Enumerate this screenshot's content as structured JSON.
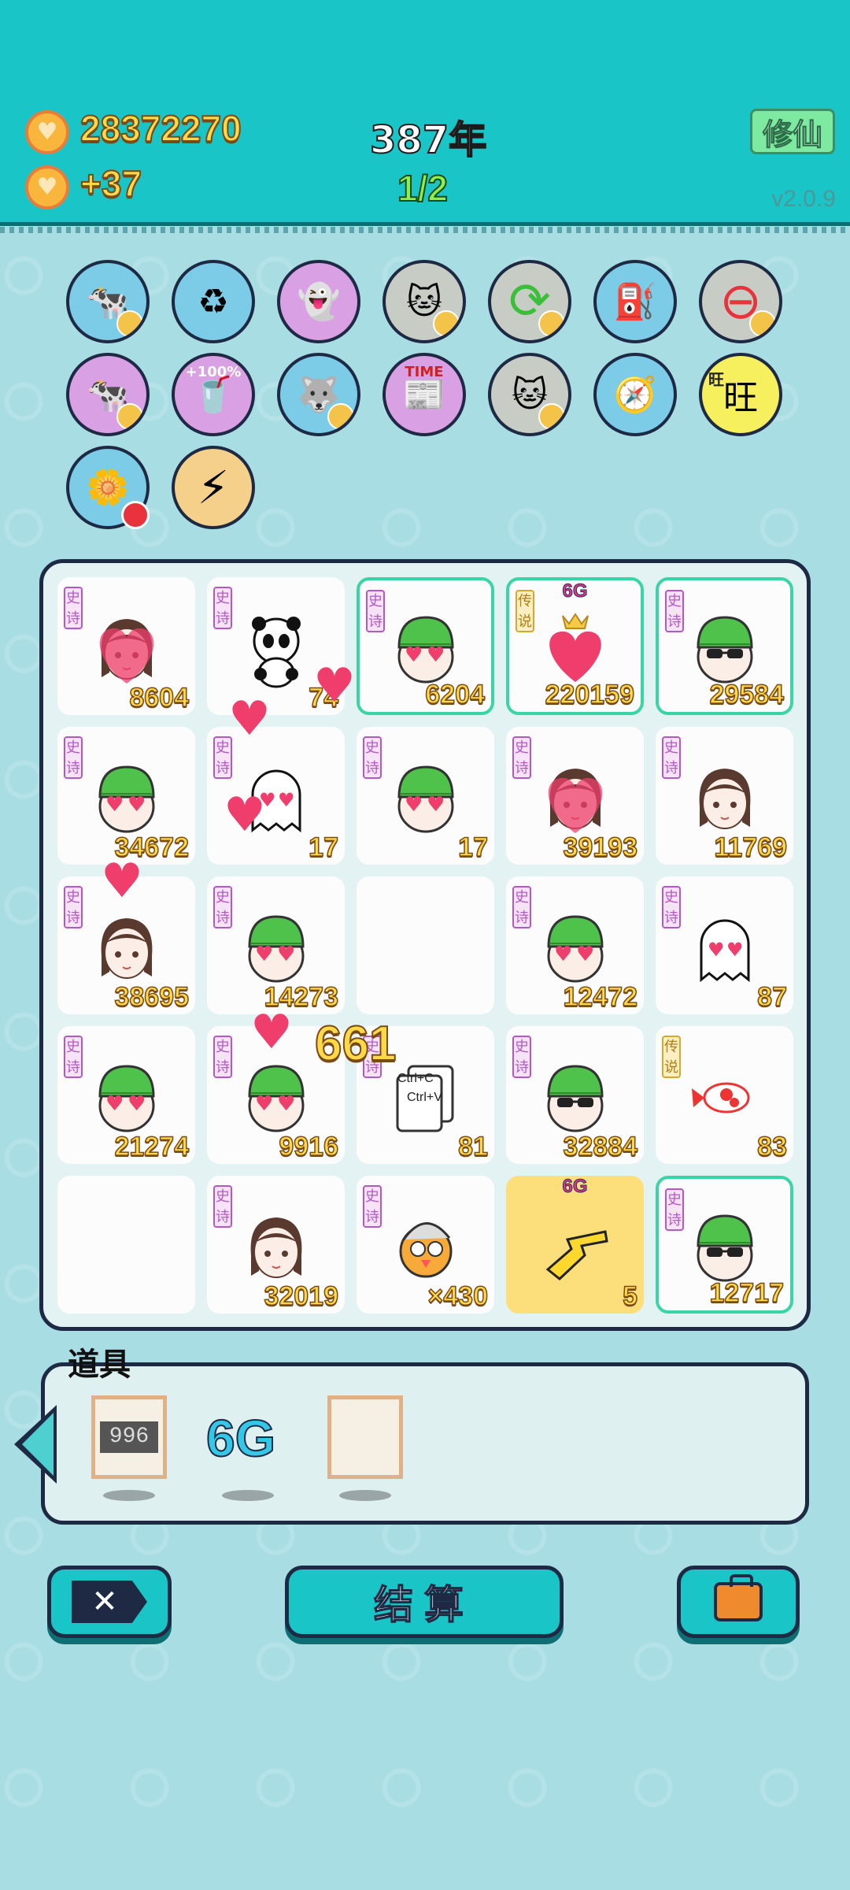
{
  "header": {
    "coins": "28372270",
    "income": "+37",
    "year": "387年",
    "page": "1/2",
    "xiuxian": "修仙",
    "version": "v2.0.9"
  },
  "abilities": [
    {
      "icon": "cow-twins-icon",
      "color": "blue"
    },
    {
      "icon": "recycle-bag-icon",
      "color": "blue"
    },
    {
      "icon": "ghost-lantern-icon",
      "color": "purple"
    },
    {
      "icon": "cat-glasses-icon",
      "color": "tan"
    },
    {
      "icon": "refresh-icon",
      "color": "tan"
    },
    {
      "icon": "pump-icon",
      "color": "blue"
    },
    {
      "icon": "minus-circle-icon",
      "color": "tan"
    },
    {
      "icon": "cow-twins-icon",
      "color": "purple"
    },
    {
      "icon": "drink-plus100-icon",
      "color": "purple",
      "text": "+100%"
    },
    {
      "icon": "husky-icon",
      "color": "blue"
    },
    {
      "icon": "time-magazine-icon",
      "color": "purple",
      "text": "TIME"
    },
    {
      "icon": "cat-glasses-icon",
      "color": "tan"
    },
    {
      "icon": "compass-icon",
      "color": "blue"
    },
    {
      "icon": "wang-icon",
      "color": "yellow",
      "text": "旺"
    },
    {
      "icon": "flower-pot-icon",
      "color": "blue"
    },
    {
      "icon": "lightning-icon",
      "color": "gold"
    }
  ],
  "board": {
    "tag_epic": "史诗",
    "tag_legend": "传说",
    "six_g": "6G",
    "ctrl_c": "Ctrl+C",
    "ctrl_v": "Ctrl+V",
    "cells": [
      {
        "face": "girl-heart",
        "tag": "epic",
        "value": "8604"
      },
      {
        "face": "panda",
        "tag": "epic",
        "value": "74"
      },
      {
        "face": "green-heart",
        "tag": "epic",
        "value": "6204",
        "hl": true
      },
      {
        "face": "heart-crown",
        "tag": "legend",
        "value": "220159",
        "hl": true,
        "sixg": true
      },
      {
        "face": "green-shades",
        "tag": "epic",
        "value": "29584",
        "hl": true
      },
      {
        "face": "green-heart",
        "tag": "epic",
        "value": "34672"
      },
      {
        "face": "ghost",
        "tag": "epic",
        "value": "17"
      },
      {
        "face": "green-heart",
        "tag": "epic",
        "value": "17"
      },
      {
        "face": "girl-heart",
        "tag": "epic",
        "value": "39193"
      },
      {
        "face": "girl",
        "tag": "epic",
        "value": "11769"
      },
      {
        "face": "girl",
        "tag": "epic",
        "value": "38695"
      },
      {
        "face": "green-heart",
        "tag": "epic",
        "value": "14273"
      },
      {
        "face": "empty",
        "tag": "",
        "value": ""
      },
      {
        "face": "green-heart",
        "tag": "epic",
        "value": "12472"
      },
      {
        "face": "ghost",
        "tag": "epic",
        "value": "87"
      },
      {
        "face": "green-heart",
        "tag": "epic",
        "value": "21274"
      },
      {
        "face": "green-heart",
        "tag": "epic",
        "value": "9916"
      },
      {
        "face": "ctrl",
        "tag": "epic",
        "value": "81"
      },
      {
        "face": "green-shades",
        "tag": "epic",
        "value": "32884"
      },
      {
        "face": "koi",
        "tag": "legend",
        "value": "83"
      },
      {
        "face": "empty",
        "tag": "",
        "value": ""
      },
      {
        "face": "girl",
        "tag": "epic",
        "value": "32019"
      },
      {
        "face": "chick",
        "tag": "epic",
        "value": "×430"
      },
      {
        "face": "pointer",
        "tag": "",
        "value": "5",
        "yellow": true,
        "sixg": true
      },
      {
        "face": "green-shades",
        "tag": "epic",
        "value": "12717",
        "hl": true
      }
    ],
    "floating_value": "661"
  },
  "tools": {
    "title": "道具",
    "slot1_text": "996",
    "slot2_text": "6G"
  },
  "buttons": {
    "settle": "结算"
  },
  "colors": {
    "header": "#1ac5c7",
    "background": "#a9dde4",
    "gold": "#ffd948",
    "outline": "#1e2a44"
  }
}
